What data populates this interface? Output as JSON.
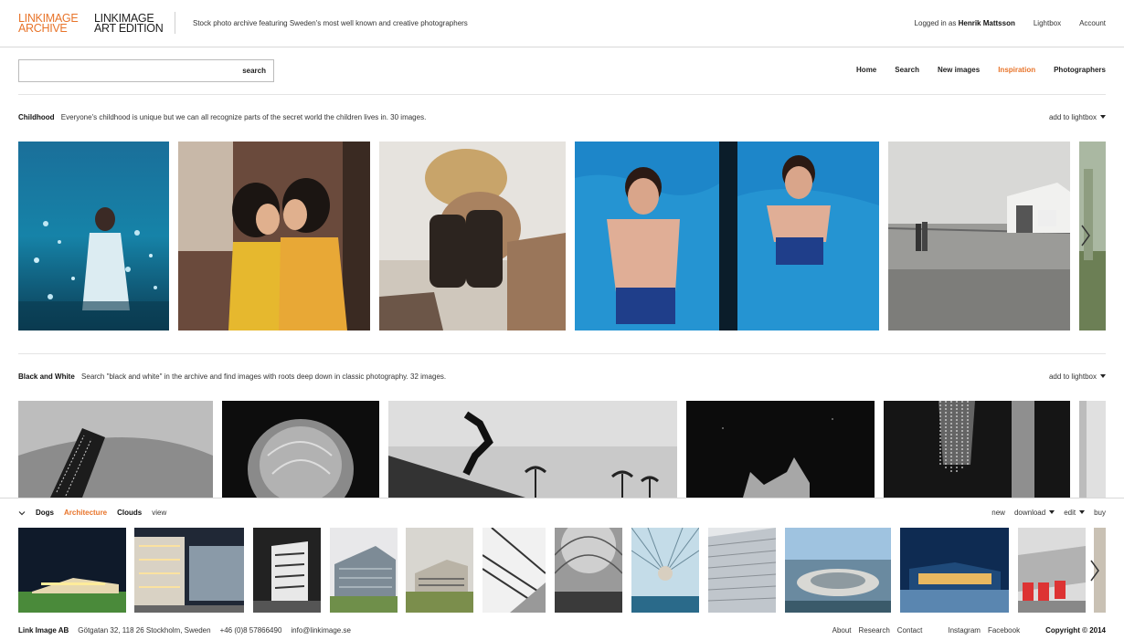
{
  "header": {
    "logo_archive_line1": "LINKIMAGE",
    "logo_archive_line2": "ARCHIVE",
    "logo_art_line1": "LINKIMAGE",
    "logo_art_line2": "ART EDITION",
    "tagline": "Stock photo archive featuring Sweden's most well known and creative photographers",
    "logged_in_prefix": "Logged in as",
    "user_name": "Henrik Mattsson",
    "lightbox": "Lightbox",
    "account": "Account"
  },
  "search": {
    "value": "",
    "placeholder": "",
    "button": "search"
  },
  "nav": {
    "home": "Home",
    "search": "Search",
    "new_images": "New images",
    "inspiration": "Inspiration",
    "photographers": "Photographers"
  },
  "sections": [
    {
      "title": "Childhood",
      "description": "Everyone's childhood is unique but we can all recognize parts of the secret world the children lives in. 30 images.",
      "add_label": "add to lightbox"
    },
    {
      "title": "Black and White",
      "description": "Search \"black and white\" in the archive and find images with roots deep down in classic photography. 32 images.",
      "add_label": "add to lightbox"
    }
  ],
  "tray": {
    "tabs": [
      "Dogs",
      "Architecture",
      "Clouds"
    ],
    "view": "view",
    "new": "new",
    "download": "download",
    "edit": "edit",
    "buy": "buy"
  },
  "footer": {
    "company": "Link Image AB",
    "address": "Götgatan 32, 118 26 Stockholm, Sweden",
    "phone": "+46 (0)8 57866490",
    "email": "info@linkimage.se",
    "about": "About",
    "research": "Research",
    "contact": "Contact",
    "instagram": "Instagram",
    "facebook": "Facebook",
    "copyright": "Copyright © 2014"
  },
  "colors": {
    "accent": "#e8742a"
  }
}
